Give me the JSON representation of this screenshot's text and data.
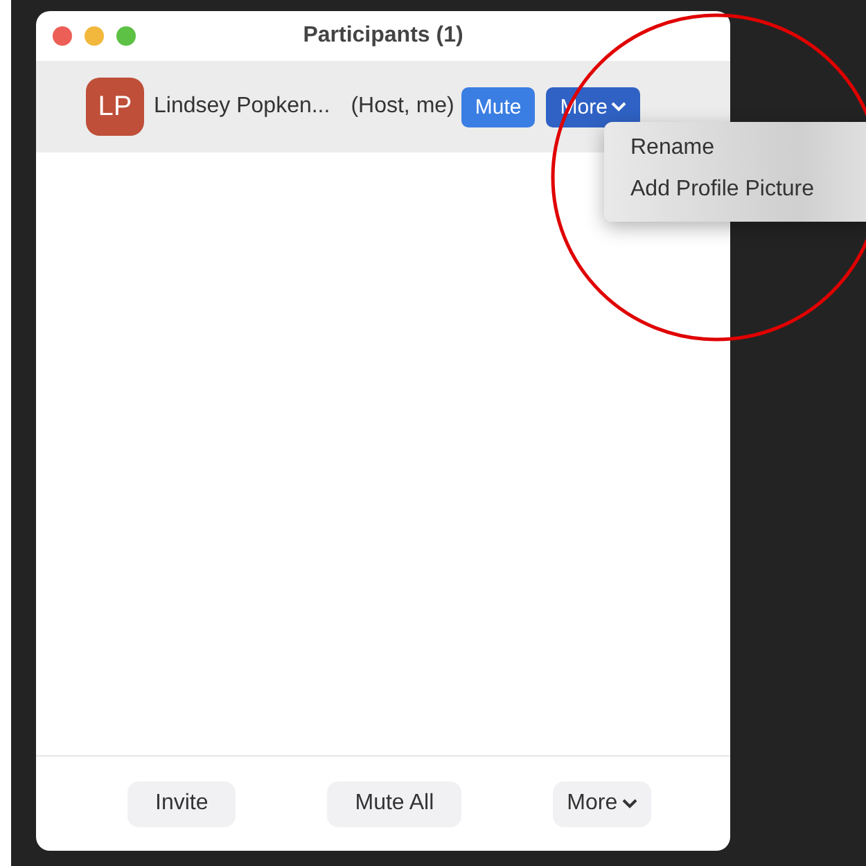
{
  "window": {
    "title": "Participants (1)"
  },
  "participants": [
    {
      "initials": "LP",
      "name": "Lindsey Popken...",
      "role": "(Host, me)",
      "mute_button": "Mute",
      "more_button": {
        "label": "More",
        "expanded": true
      }
    }
  ],
  "menu": {
    "items": [
      "Rename",
      "Add Profile Picture"
    ]
  },
  "footer_buttons": [
    {
      "label": "Invite",
      "kind": "plain"
    },
    {
      "label": "Mute All",
      "kind": "plain"
    },
    {
      "label": "More",
      "kind": "dropdown"
    }
  ]
}
